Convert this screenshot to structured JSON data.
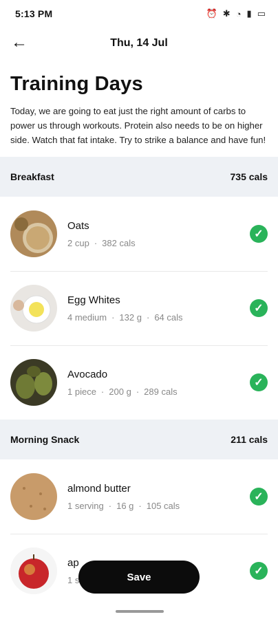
{
  "status": {
    "time": "5:13 PM"
  },
  "header": {
    "date": "Thu, 14 Jul"
  },
  "title": "Training Days",
  "description": "Today, we are going to eat just the right amount of carbs to power us through workouts. Protein also needs to be on higher side. Watch that fat intake. Try to strike a balance and have fun!",
  "breakfast": {
    "label": "Breakfast",
    "cals": "735 cals",
    "items": [
      {
        "name": "Oats",
        "qty": "2 cup",
        "cals": "382 cals"
      },
      {
        "name": "Egg Whites",
        "qty": "4 medium",
        "weight": "132 g",
        "cals": "64 cals"
      },
      {
        "name": "Avocado",
        "qty": "1 piece",
        "weight": "200 g",
        "cals": "289 cals"
      }
    ]
  },
  "snack": {
    "label": "Morning Snack",
    "cals": "211 cals",
    "items": [
      {
        "name": "almond butter",
        "qty": "1 serving",
        "weight": "16 g",
        "cals": "105 cals"
      },
      {
        "name": "ap",
        "qty": "1 serv"
      }
    ]
  },
  "save_label": "Save",
  "colors": {
    "check": "#2ab35a",
    "section_bg": "#eef1f5"
  }
}
